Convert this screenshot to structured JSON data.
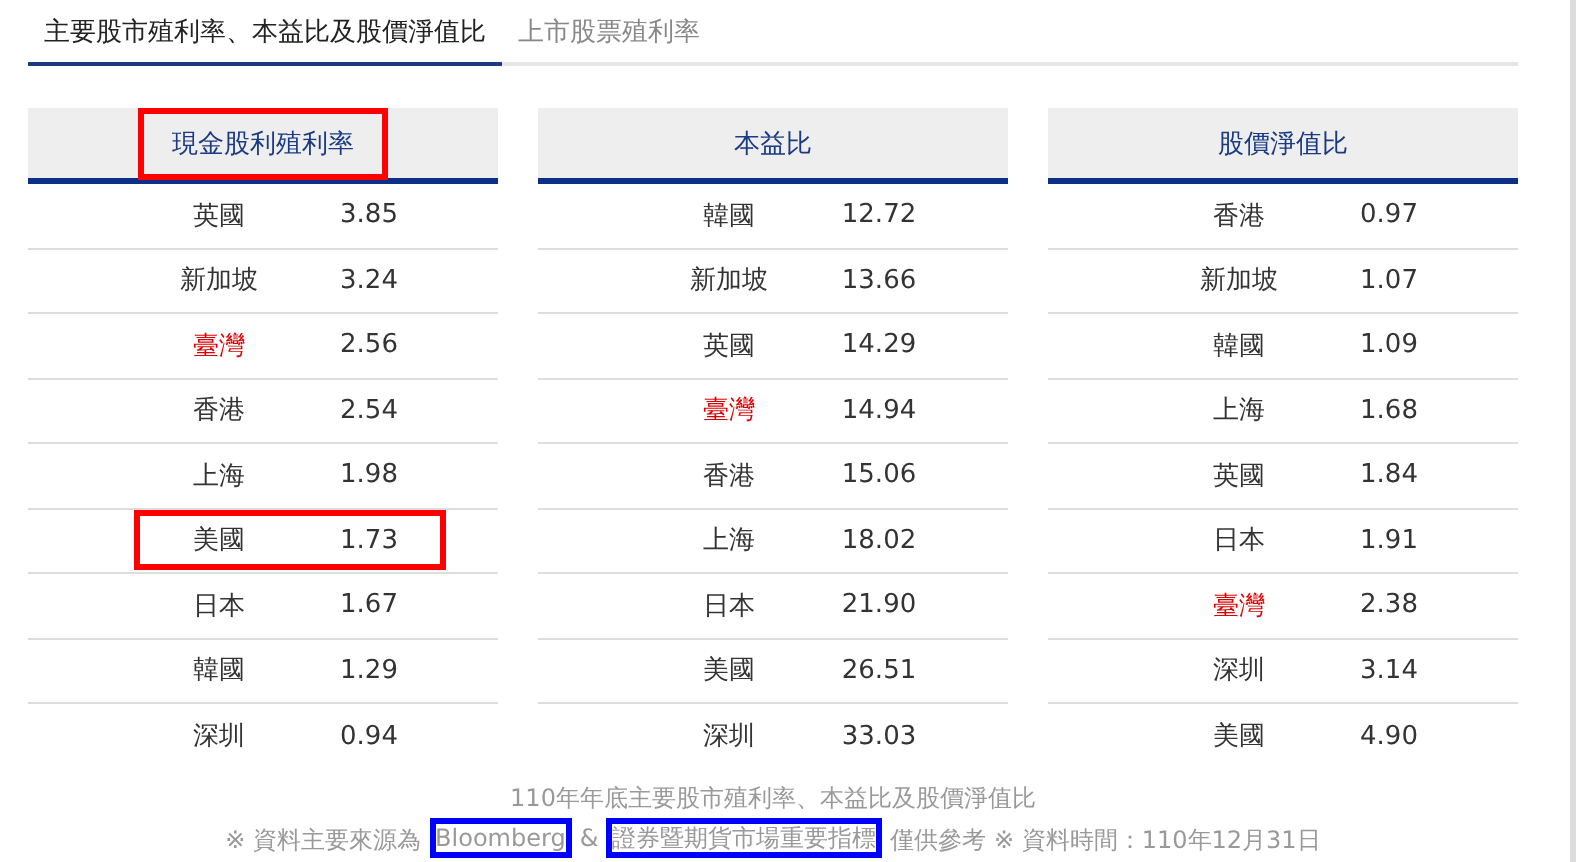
{
  "tabs": [
    {
      "label": "主要股市殖利率、本益比及股價淨值比",
      "selected": true
    },
    {
      "label": "上市股票殖利率",
      "selected": false
    }
  ],
  "tables": [
    {
      "heading": "現金股利殖利率",
      "highlighted": true,
      "rows": [
        {
          "market": "英國",
          "value": "3.85",
          "emphasized": false,
          "highlighted": false
        },
        {
          "market": "新加坡",
          "value": "3.24",
          "emphasized": false,
          "highlighted": false
        },
        {
          "market": "臺灣",
          "value": "2.56",
          "emphasized": true,
          "highlighted": false
        },
        {
          "market": "香港",
          "value": "2.54",
          "emphasized": false,
          "highlighted": false
        },
        {
          "market": "上海",
          "value": "1.98",
          "emphasized": false,
          "highlighted": false
        },
        {
          "market": "美國",
          "value": "1.73",
          "emphasized": false,
          "highlighted": true
        },
        {
          "market": "日本",
          "value": "1.67",
          "emphasized": false,
          "highlighted": false
        },
        {
          "market": "韓國",
          "value": "1.29",
          "emphasized": false,
          "highlighted": false
        },
        {
          "market": "深圳",
          "value": "0.94",
          "emphasized": false,
          "highlighted": false
        }
      ]
    },
    {
      "heading": "本益比",
      "highlighted": false,
      "rows": [
        {
          "market": "韓國",
          "value": "12.72",
          "emphasized": false,
          "highlighted": false
        },
        {
          "market": "新加坡",
          "value": "13.66",
          "emphasized": false,
          "highlighted": false
        },
        {
          "market": "英國",
          "value": "14.29",
          "emphasized": false,
          "highlighted": false
        },
        {
          "market": "臺灣",
          "value": "14.94",
          "emphasized": true,
          "highlighted": false
        },
        {
          "market": "香港",
          "value": "15.06",
          "emphasized": false,
          "highlighted": false
        },
        {
          "market": "上海",
          "value": "18.02",
          "emphasized": false,
          "highlighted": false
        },
        {
          "market": "日本",
          "value": "21.90",
          "emphasized": false,
          "highlighted": false
        },
        {
          "market": "美國",
          "value": "26.51",
          "emphasized": false,
          "highlighted": false
        },
        {
          "market": "深圳",
          "value": "33.03",
          "emphasized": false,
          "highlighted": false
        }
      ]
    },
    {
      "heading": "股價淨值比",
      "highlighted": false,
      "rows": [
        {
          "market": "香港",
          "value": "0.97",
          "emphasized": false,
          "highlighted": false
        },
        {
          "market": "新加坡",
          "value": "1.07",
          "emphasized": false,
          "highlighted": false
        },
        {
          "market": "韓國",
          "value": "1.09",
          "emphasized": false,
          "highlighted": false
        },
        {
          "market": "上海",
          "value": "1.68",
          "emphasized": false,
          "highlighted": false
        },
        {
          "market": "英國",
          "value": "1.84",
          "emphasized": false,
          "highlighted": false
        },
        {
          "market": "日本",
          "value": "1.91",
          "emphasized": false,
          "highlighted": false
        },
        {
          "market": "臺灣",
          "value": "2.38",
          "emphasized": true,
          "highlighted": false
        },
        {
          "market": "深圳",
          "value": "3.14",
          "emphasized": false,
          "highlighted": false
        },
        {
          "market": "美國",
          "value": "4.90",
          "emphasized": false,
          "highlighted": false
        }
      ]
    }
  ],
  "caption": "110年年底主要股市殖利率、本益比及股價淨值比",
  "footer": {
    "prefix": "※ 資料主要來源為",
    "links": [
      {
        "label": "Bloomberg",
        "highlighted": true
      },
      {
        "label": "證券暨期貨市場重要指標",
        "highlighted": true
      }
    ],
    "separator": "&",
    "suffix": "僅供參考 ※ 資料時間：110年12月31日"
  }
}
